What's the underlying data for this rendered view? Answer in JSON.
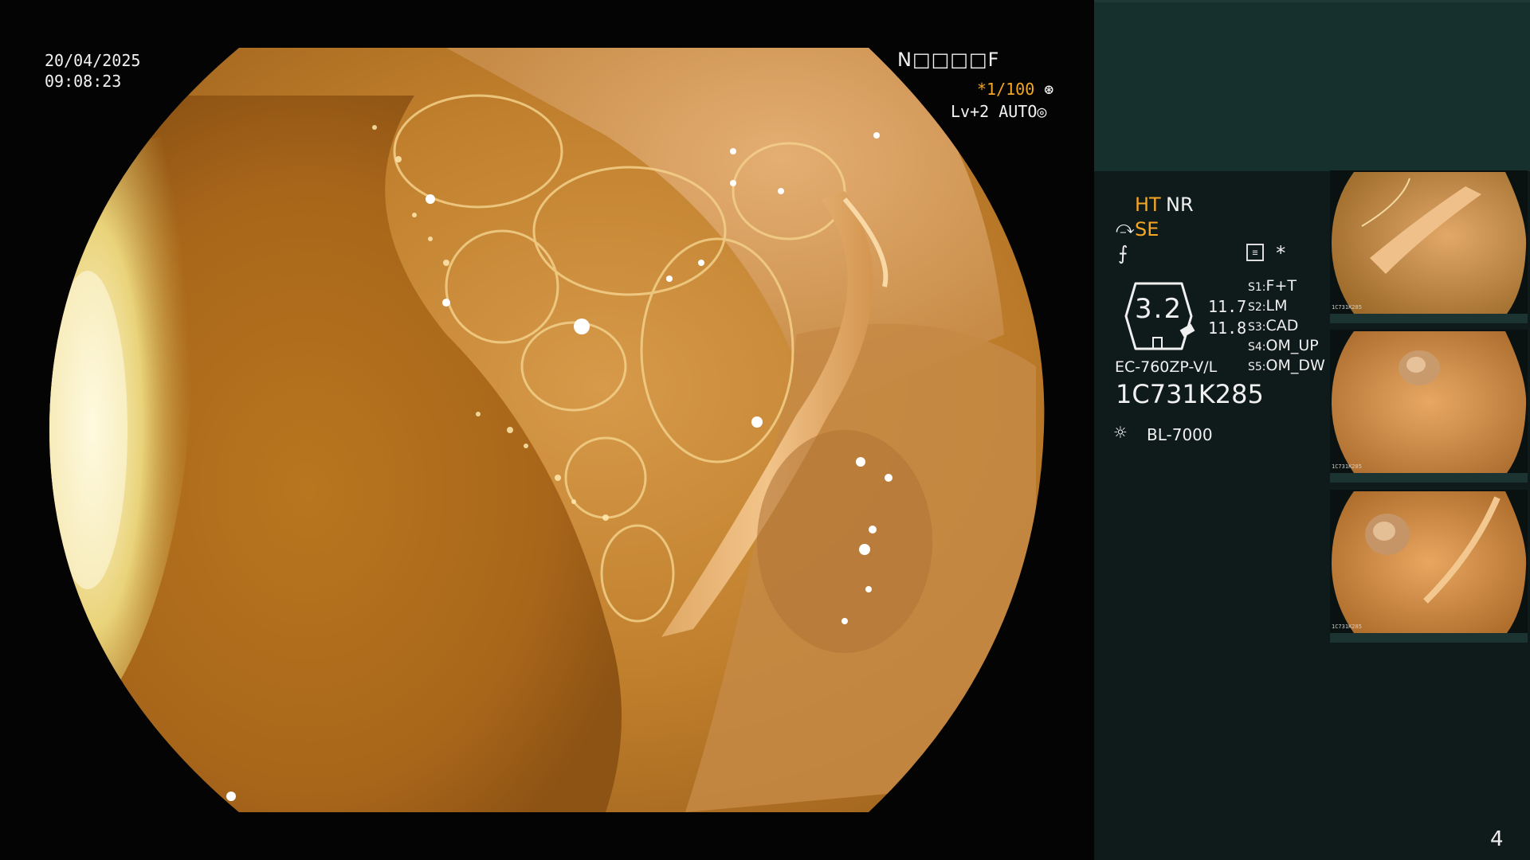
{
  "overlay": {
    "date": "20/04/2025",
    "time": "09:08:23",
    "patient_id": "N□□□□F",
    "shutter": "*1/100",
    "shutter_icon": "aperture-wheel-icon",
    "level": "Lv+2 AUTO",
    "auto_icon": "iris-icon"
  },
  "panel": {
    "mode_ht": "HT",
    "mode_nr": "NR",
    "mode_se": "SE",
    "se_icon": "⤼",
    "freeze_icon": "⨍",
    "star": "*",
    "gauge_value": "3.2",
    "gauge_readout_1": "11.7",
    "gauge_readout_2": "11.8",
    "switches": [
      {
        "key": "S1:",
        "value": "F+T"
      },
      {
        "key": "S2:",
        "value": "LM"
      },
      {
        "key": "S3:",
        "value": "CAD"
      },
      {
        "key": "S4:",
        "value": "OM_UP"
      },
      {
        "key": "S5:",
        "value": "OM_DW"
      }
    ],
    "scope_model": "EC-760ZP-V/L",
    "scope_serial": "1C731K285",
    "light_icon": "☼",
    "light_source": "BL-7000",
    "page_number": "4"
  },
  "thumbnails": [
    {
      "serial": "1C731K285"
    },
    {
      "serial": "1C731K285"
    },
    {
      "serial": "1C731K285"
    }
  ],
  "colors": {
    "accent": "#f5a623",
    "panel_bg": "#0e1b1a",
    "panel_top": "#16302d"
  }
}
